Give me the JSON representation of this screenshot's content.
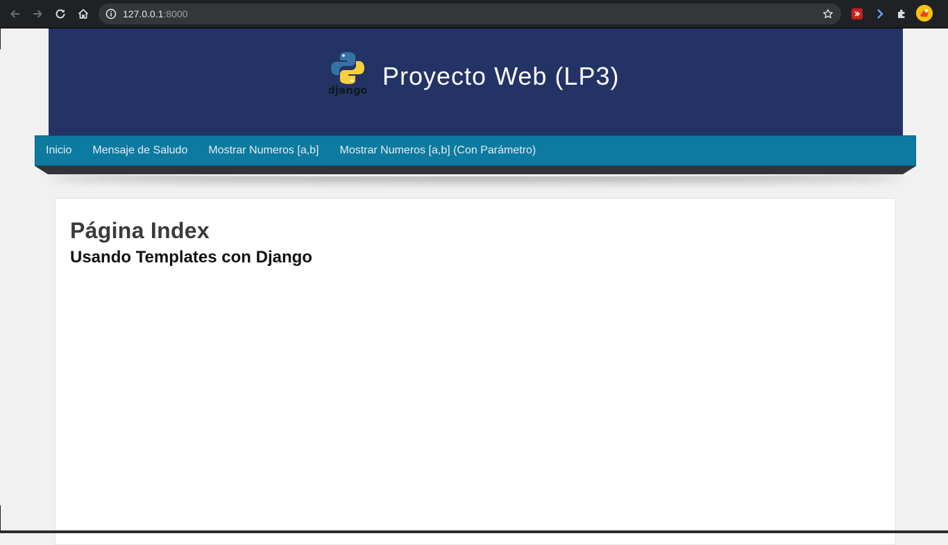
{
  "browser": {
    "url_host": "127.0.0.1",
    "url_port": ":8000",
    "icons": {
      "back": "arrow-left-icon",
      "forward": "arrow-right-icon",
      "reload": "reload-icon",
      "home": "home-icon",
      "info": "info-icon",
      "bookmark": "star-icon",
      "extensions": "puzzle-icon"
    },
    "colors": {
      "toolbar": "#202124",
      "omnibox": "#35363a"
    }
  },
  "header": {
    "title": "Proyecto Web (LP3)",
    "logo_text": "django",
    "background": "#243366"
  },
  "nav": {
    "background": "#0d7aa0",
    "items": [
      {
        "label": "Inicio"
      },
      {
        "label": "Mensaje de Saludo"
      },
      {
        "label": "Mostrar Numeros [a,b]"
      },
      {
        "label": "Mostrar Numeros [a,b] (Con Parámetro)"
      }
    ]
  },
  "main": {
    "heading": "Página Index",
    "subheading": "Usando Templates con Django"
  }
}
